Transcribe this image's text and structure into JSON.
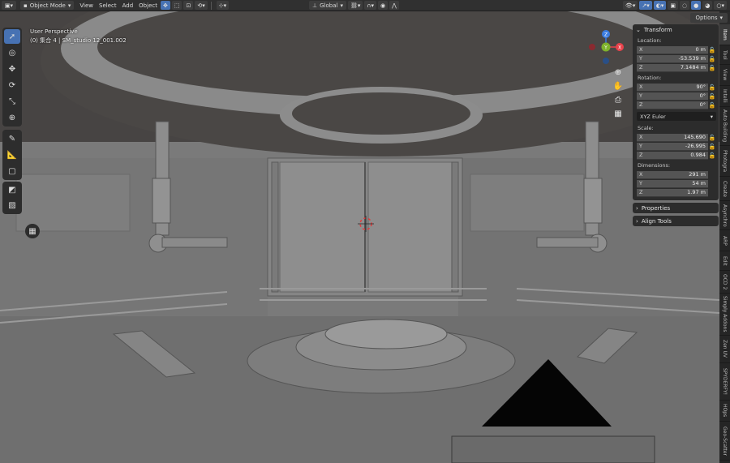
{
  "header": {
    "mode": "Object Mode",
    "menus": [
      "View",
      "Select",
      "Add",
      "Object"
    ],
    "orientation": "Global",
    "options_label": "Options"
  },
  "viewport": {
    "view_name": "User Perspective",
    "collection_info": "(0) 集合 4 | SM_studio 12_001.002"
  },
  "gizmo": {
    "z": "Z",
    "x": "X",
    "y": "Y"
  },
  "panel": {
    "transform_title": "Transform",
    "location_label": "Location:",
    "location": [
      {
        "axis": "X",
        "value": "0 m"
      },
      {
        "axis": "Y",
        "value": "-53.539 m"
      },
      {
        "axis": "Z",
        "value": "7.1484 m"
      }
    ],
    "rotation_label": "Rotation:",
    "rotation": [
      {
        "axis": "X",
        "value": "90°"
      },
      {
        "axis": "Y",
        "value": "0°"
      },
      {
        "axis": "Z",
        "value": "0°"
      }
    ],
    "rotation_mode": "XYZ Euler",
    "scale_label": "Scale:",
    "scale": [
      {
        "axis": "X",
        "value": "145.690"
      },
      {
        "axis": "Y",
        "value": "-26.995"
      },
      {
        "axis": "Z",
        "value": "0.984"
      }
    ],
    "dimensions_label": "Dimensions:",
    "dimensions": [
      {
        "axis": "X",
        "value": "291 m"
      },
      {
        "axis": "Y",
        "value": "54 m"
      },
      {
        "axis": "Z",
        "value": "1.97 m"
      }
    ],
    "properties_title": "Properties",
    "align_tools_title": "Align Tools"
  },
  "tabs": [
    "Item",
    "Tool",
    "View",
    "Intelli",
    "Auto Building",
    "Photogra",
    "Create",
    "Asynchro",
    "ARP",
    "Edit",
    "OCD 2",
    "Simply Addons",
    "Zen UV",
    "SPYDERFY!",
    "HOps",
    "Geo-Scatter"
  ],
  "colors": {
    "accent": "#4772b3",
    "axis_x": "#e8424b",
    "axis_y": "#7fb32c",
    "axis_z": "#3b7ce0"
  }
}
